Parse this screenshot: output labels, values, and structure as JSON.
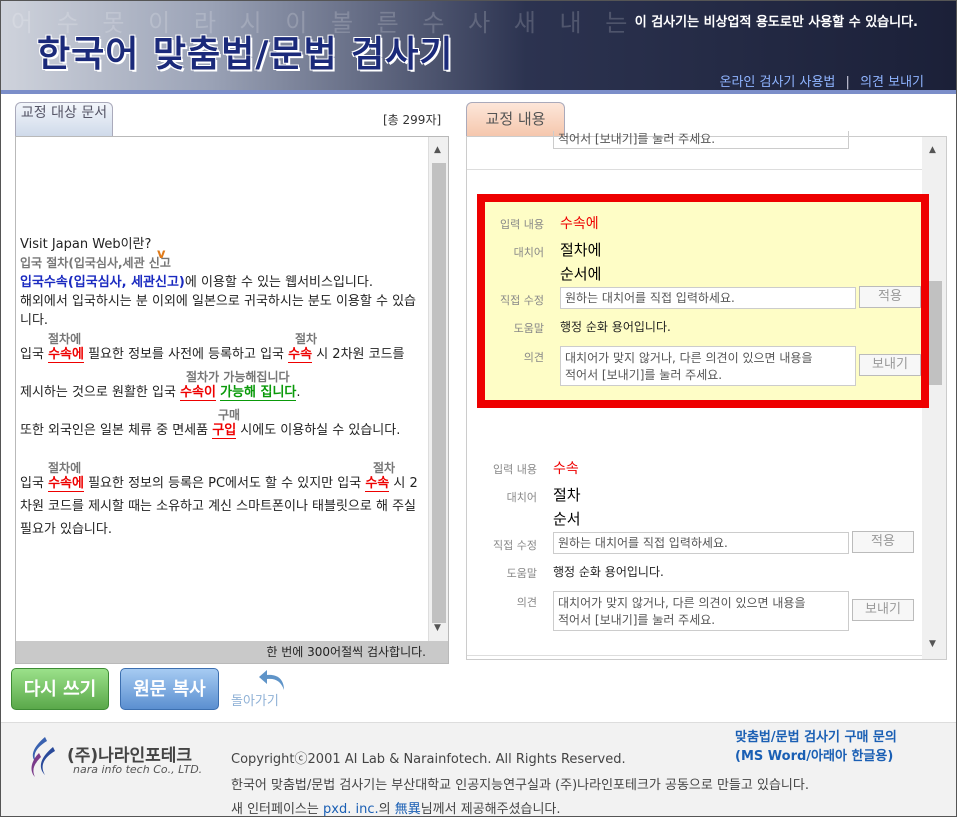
{
  "header": {
    "bg_text": "어 수 못 이 라 시 이 볼 른 수 사 새 내 는",
    "title": "한국어 맞춤법/문법 검사기",
    "notice": "이 검사기는 비상업적 용도로만 사용할 수 있습니다.",
    "link_manual": "온라인 검사기 사용법",
    "link_sep": "|",
    "link_feedback": "의견 보내기"
  },
  "left": {
    "tab_label": "교정 대상 문서",
    "count": "[총 299자]",
    "footer": "한 번에 300어절씩 검사합니다.",
    "lines": {
      "l1": "Visit Japan Web이란?",
      "l2": "입국 절차(입국심사,세관 신고",
      "l3a": "입국수속(입국심사, 세관신고)",
      "l3b": "에 이용할 수 있는 웹서비스입니다.",
      "l4": "해외에서 입국하시는 분 이외에 일본으로 귀국하시는 분도 이용할 수 있습",
      "l5": "니다.",
      "a6a": "절차에",
      "a6b": "절차",
      "l6a": "입국 ",
      "l6b": "수속에",
      "l6c": " 필요한 정보를 사전에 등록하고 입국 ",
      "l6d": "수속",
      "l6e": " 시 2차원 코드를",
      "a7": "절차가 가능해집니다",
      "l7a": "제시하는 것으로 원활한 입국 ",
      "l7b": "수속이",
      "l7c": " ",
      "l7d": "가능해 집니다",
      "l7e": ".",
      "a8": "구매",
      "l8a": "또한 외국인은 일본 체류 중 면세품 ",
      "l8b": "구입",
      "l8c": " 시에도 이용하실 수 있습니다.",
      "a9a": "절차에",
      "a9b": "절차",
      "l9a": "입국 ",
      "l9b": "수속에",
      "l9c": " 필요한 정보의 등록은 PC에서도 할 수 있지만 입국 ",
      "l9d": "수속",
      "l9e": " 시 2",
      "l10": "차원 코드를 제시할 때는 소유하고 계신 스마트폰이나 태블릿으로 해 주실",
      "l11": "필요가 있습니다."
    }
  },
  "right": {
    "tab_label": "교정 내용",
    "top_partial": "적어서 [보내기]를 눌러 주세요.",
    "labels": {
      "input": "입력 내용",
      "suggest": "대치어",
      "direct": "직접 수정",
      "help": "도움말",
      "opinion": "의견"
    },
    "input_placeholder": "원하는 대치어를 직접 입력하세요.",
    "apply": "적용",
    "opinion_line1": "대치어가 맞지 않거나, 다른 의견이 있으면 내용을",
    "opinion_line2": "적어서 [보내기]를 눌러 주세요.",
    "send": "보내기",
    "card1": {
      "input": "수속에",
      "s1": "절차에",
      "s2": "순서에",
      "help": "행정 순화 용어입니다."
    },
    "card2": {
      "input": "수속",
      "s1": "절차",
      "s2": "순서",
      "help": "행정 순화 용어입니다."
    }
  },
  "buttons": {
    "rewrite": "다시 쓰기",
    "copy": "원문 복사",
    "back": "돌아가기"
  },
  "footer": {
    "logo_kr": "(주)나라인포테크",
    "logo_en": "nara info tech Co., LTD.",
    "copyright": "Copyrightⓒ2001 AI Lab & Narainfotech. All Rights Reserved.",
    "line2": "한국어 맞춤법/문법 검사기는 부산대학교 인공지능연구실과 (주)나라인포테크가 공동으로 만들고 있습니다.",
    "line3a": "새 인터페이스는 ",
    "line3b": "pxd. inc.",
    "line3c": "의 ",
    "line3d": "無異",
    "line3e": "님께서 제공해주셨습니다.",
    "buy1": "맞춤법/문법 검사기 구매 문의",
    "buy2": "(MS Word/아래아 한글용)"
  }
}
